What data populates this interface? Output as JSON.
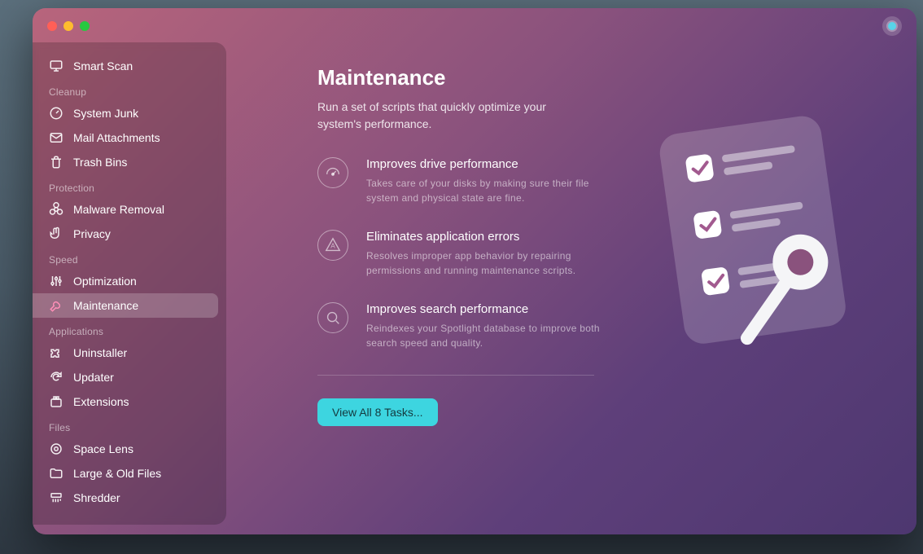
{
  "sidebar": {
    "top": {
      "label": "Smart Scan",
      "icon": "monitor-icon"
    },
    "groups": [
      {
        "title": "Cleanup",
        "items": [
          {
            "label": "System Junk",
            "icon": "gauge-icon"
          },
          {
            "label": "Mail Attachments",
            "icon": "envelope-icon"
          },
          {
            "label": "Trash Bins",
            "icon": "trash-icon"
          }
        ]
      },
      {
        "title": "Protection",
        "items": [
          {
            "label": "Malware Removal",
            "icon": "biohazard-icon"
          },
          {
            "label": "Privacy",
            "icon": "hand-icon"
          }
        ]
      },
      {
        "title": "Speed",
        "items": [
          {
            "label": "Optimization",
            "icon": "sliders-icon"
          },
          {
            "label": "Maintenance",
            "icon": "wrench-icon",
            "active": true
          }
        ]
      },
      {
        "title": "Applications",
        "items": [
          {
            "label": "Uninstaller",
            "icon": "puzzle-icon"
          },
          {
            "label": "Updater",
            "icon": "refresh-icon"
          },
          {
            "label": "Extensions",
            "icon": "addon-icon"
          }
        ]
      },
      {
        "title": "Files",
        "items": [
          {
            "label": "Space Lens",
            "icon": "lens-icon"
          },
          {
            "label": "Large & Old Files",
            "icon": "folder-icon"
          },
          {
            "label": "Shredder",
            "icon": "shredder-icon"
          }
        ]
      }
    ]
  },
  "main": {
    "title": "Maintenance",
    "subtitle": "Run a set of scripts that quickly optimize your system's performance.",
    "features": [
      {
        "icon": "speedometer-icon",
        "title": "Improves drive performance",
        "desc": "Takes care of your disks by making sure their file system and physical state are fine."
      },
      {
        "icon": "warning-triangle-icon",
        "title": "Eliminates application errors",
        "desc": "Resolves improper app behavior by repairing permissions and running maintenance scripts."
      },
      {
        "icon": "magnifier-icon",
        "title": "Improves search performance",
        "desc": "Reindexes your Spotlight database to improve both search speed and quality."
      }
    ],
    "button": "View All 8 Tasks..."
  },
  "colors": {
    "accent": "#3dd5e0"
  }
}
